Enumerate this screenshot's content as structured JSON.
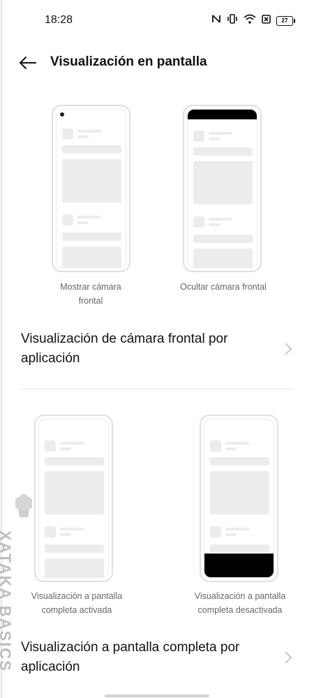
{
  "status_bar": {
    "time": "18:28",
    "battery": "27"
  },
  "header": {
    "title": "Visualización en pantalla"
  },
  "camera_options": [
    {
      "caption": "Mostrar cámara\nfrontal"
    },
    {
      "caption": "Ocultar cámara frontal"
    }
  ],
  "row_front_camera": {
    "label": "Visualización de cámara frontal por aplicación"
  },
  "fullscreen_options": [
    {
      "caption": "Visualización a pantalla\ncompleta activada"
    },
    {
      "caption": "Visualización a pantalla\ncompleta desactivada"
    }
  ],
  "row_fullscreen": {
    "label": "Visualización a pantalla completa por aplicación"
  },
  "watermark": {
    "text": "XATAKA BASICS"
  }
}
